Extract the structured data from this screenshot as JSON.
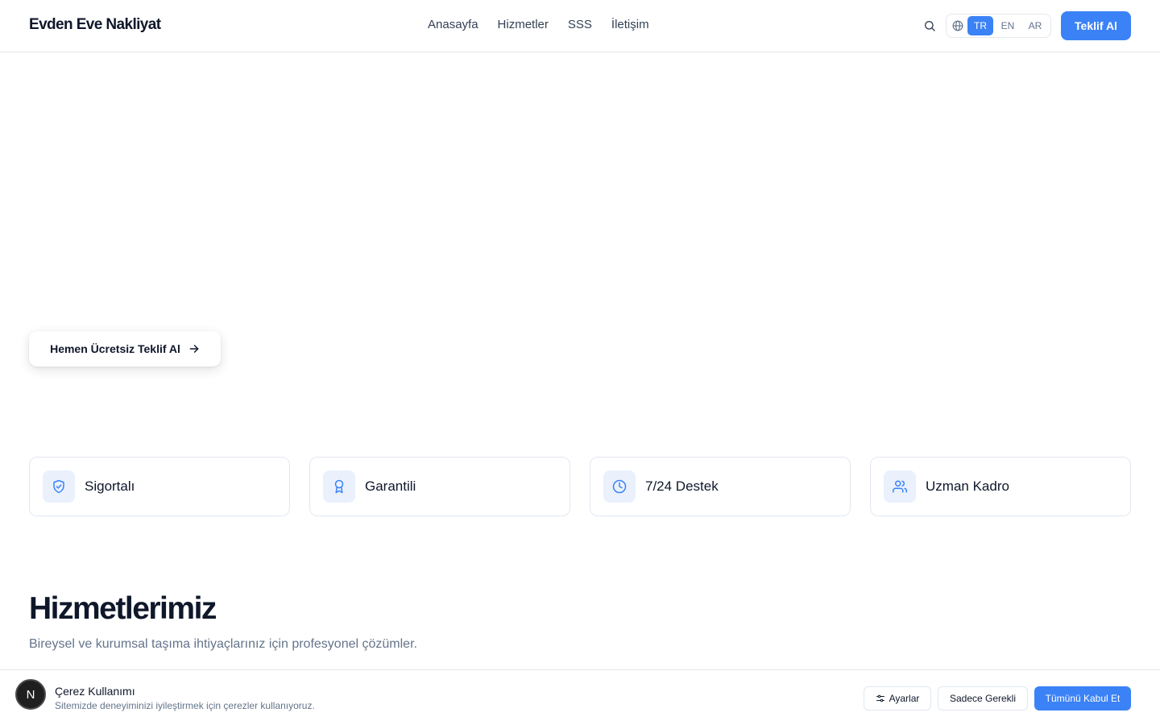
{
  "header": {
    "logo": "Evden Eve Nakliyat",
    "nav": [
      "Anasayfa",
      "Hizmetler",
      "SSS",
      "İletişim"
    ],
    "languages": [
      "TR",
      "EN",
      "AR"
    ],
    "active_language": "TR",
    "cta_label": "Teklif Al"
  },
  "hero": {
    "cta_label": "Hemen Ücretsiz Teklif Al"
  },
  "features": [
    {
      "label": "Sigortalı",
      "icon": "shield-check-icon"
    },
    {
      "label": "Garantili",
      "icon": "award-icon"
    },
    {
      "label": "7/24 Destek",
      "icon": "clock-icon"
    },
    {
      "label": "Uzman Kadro",
      "icon": "users-icon"
    }
  ],
  "services": {
    "title": "Hizmetlerimiz",
    "subtitle": "Bireysel ve kurumsal taşıma ihtiyaçlarınız için profesyonel çözümler."
  },
  "cookie": {
    "badge": "N",
    "title": "Çerez Kullanımı",
    "description": "Sitemizde deneyiminizi iyileştirmek için çerezler kullanıyoruz.",
    "settings_label": "Ayarlar",
    "necessary_label": "Sadece Gerekli",
    "accept_label": "Tümünü Kabul Et"
  },
  "colors": {
    "accent": "#3b82f6",
    "icon_bg": "#eaf1fd"
  }
}
